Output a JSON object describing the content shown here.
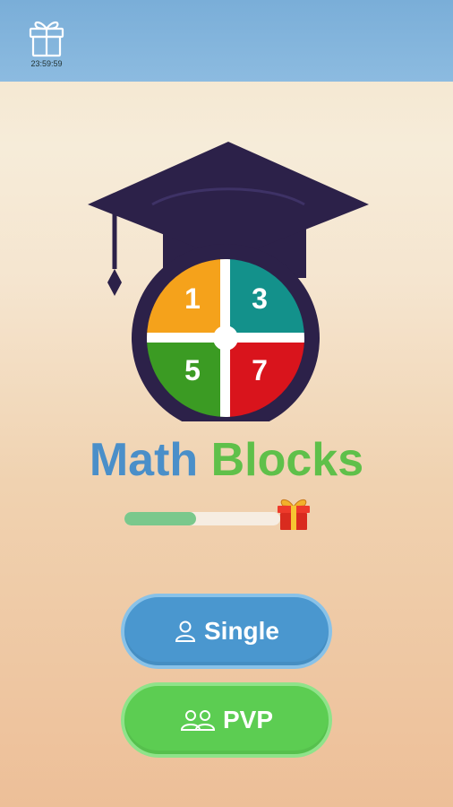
{
  "header": {
    "gift_icon": "gift-outline-icon",
    "timer": "23:59:59"
  },
  "logo": {
    "icon": "graduation-cap-icon",
    "tiles": [
      {
        "label": "1",
        "color": "#f5a21b"
      },
      {
        "label": "3",
        "color": "#13918b"
      },
      {
        "label": "5",
        "color": "#3b9b23"
      },
      {
        "label": "7",
        "color": "#d9141c"
      }
    ],
    "cap_color": "#2c2149"
  },
  "title": {
    "word1": "Math",
    "word2": "Blocks",
    "word1_color": "#4a8fc9",
    "word2_color": "#5fc04a"
  },
  "progress": {
    "fraction": 0.46,
    "reward_icon": "gift-box-icon"
  },
  "buttons": {
    "single": {
      "label": "Single",
      "icon": "person-icon",
      "color": "#4a97cf"
    },
    "pvp": {
      "label": "PVP",
      "icon": "two-people-icon",
      "color": "#5ccd52"
    }
  }
}
